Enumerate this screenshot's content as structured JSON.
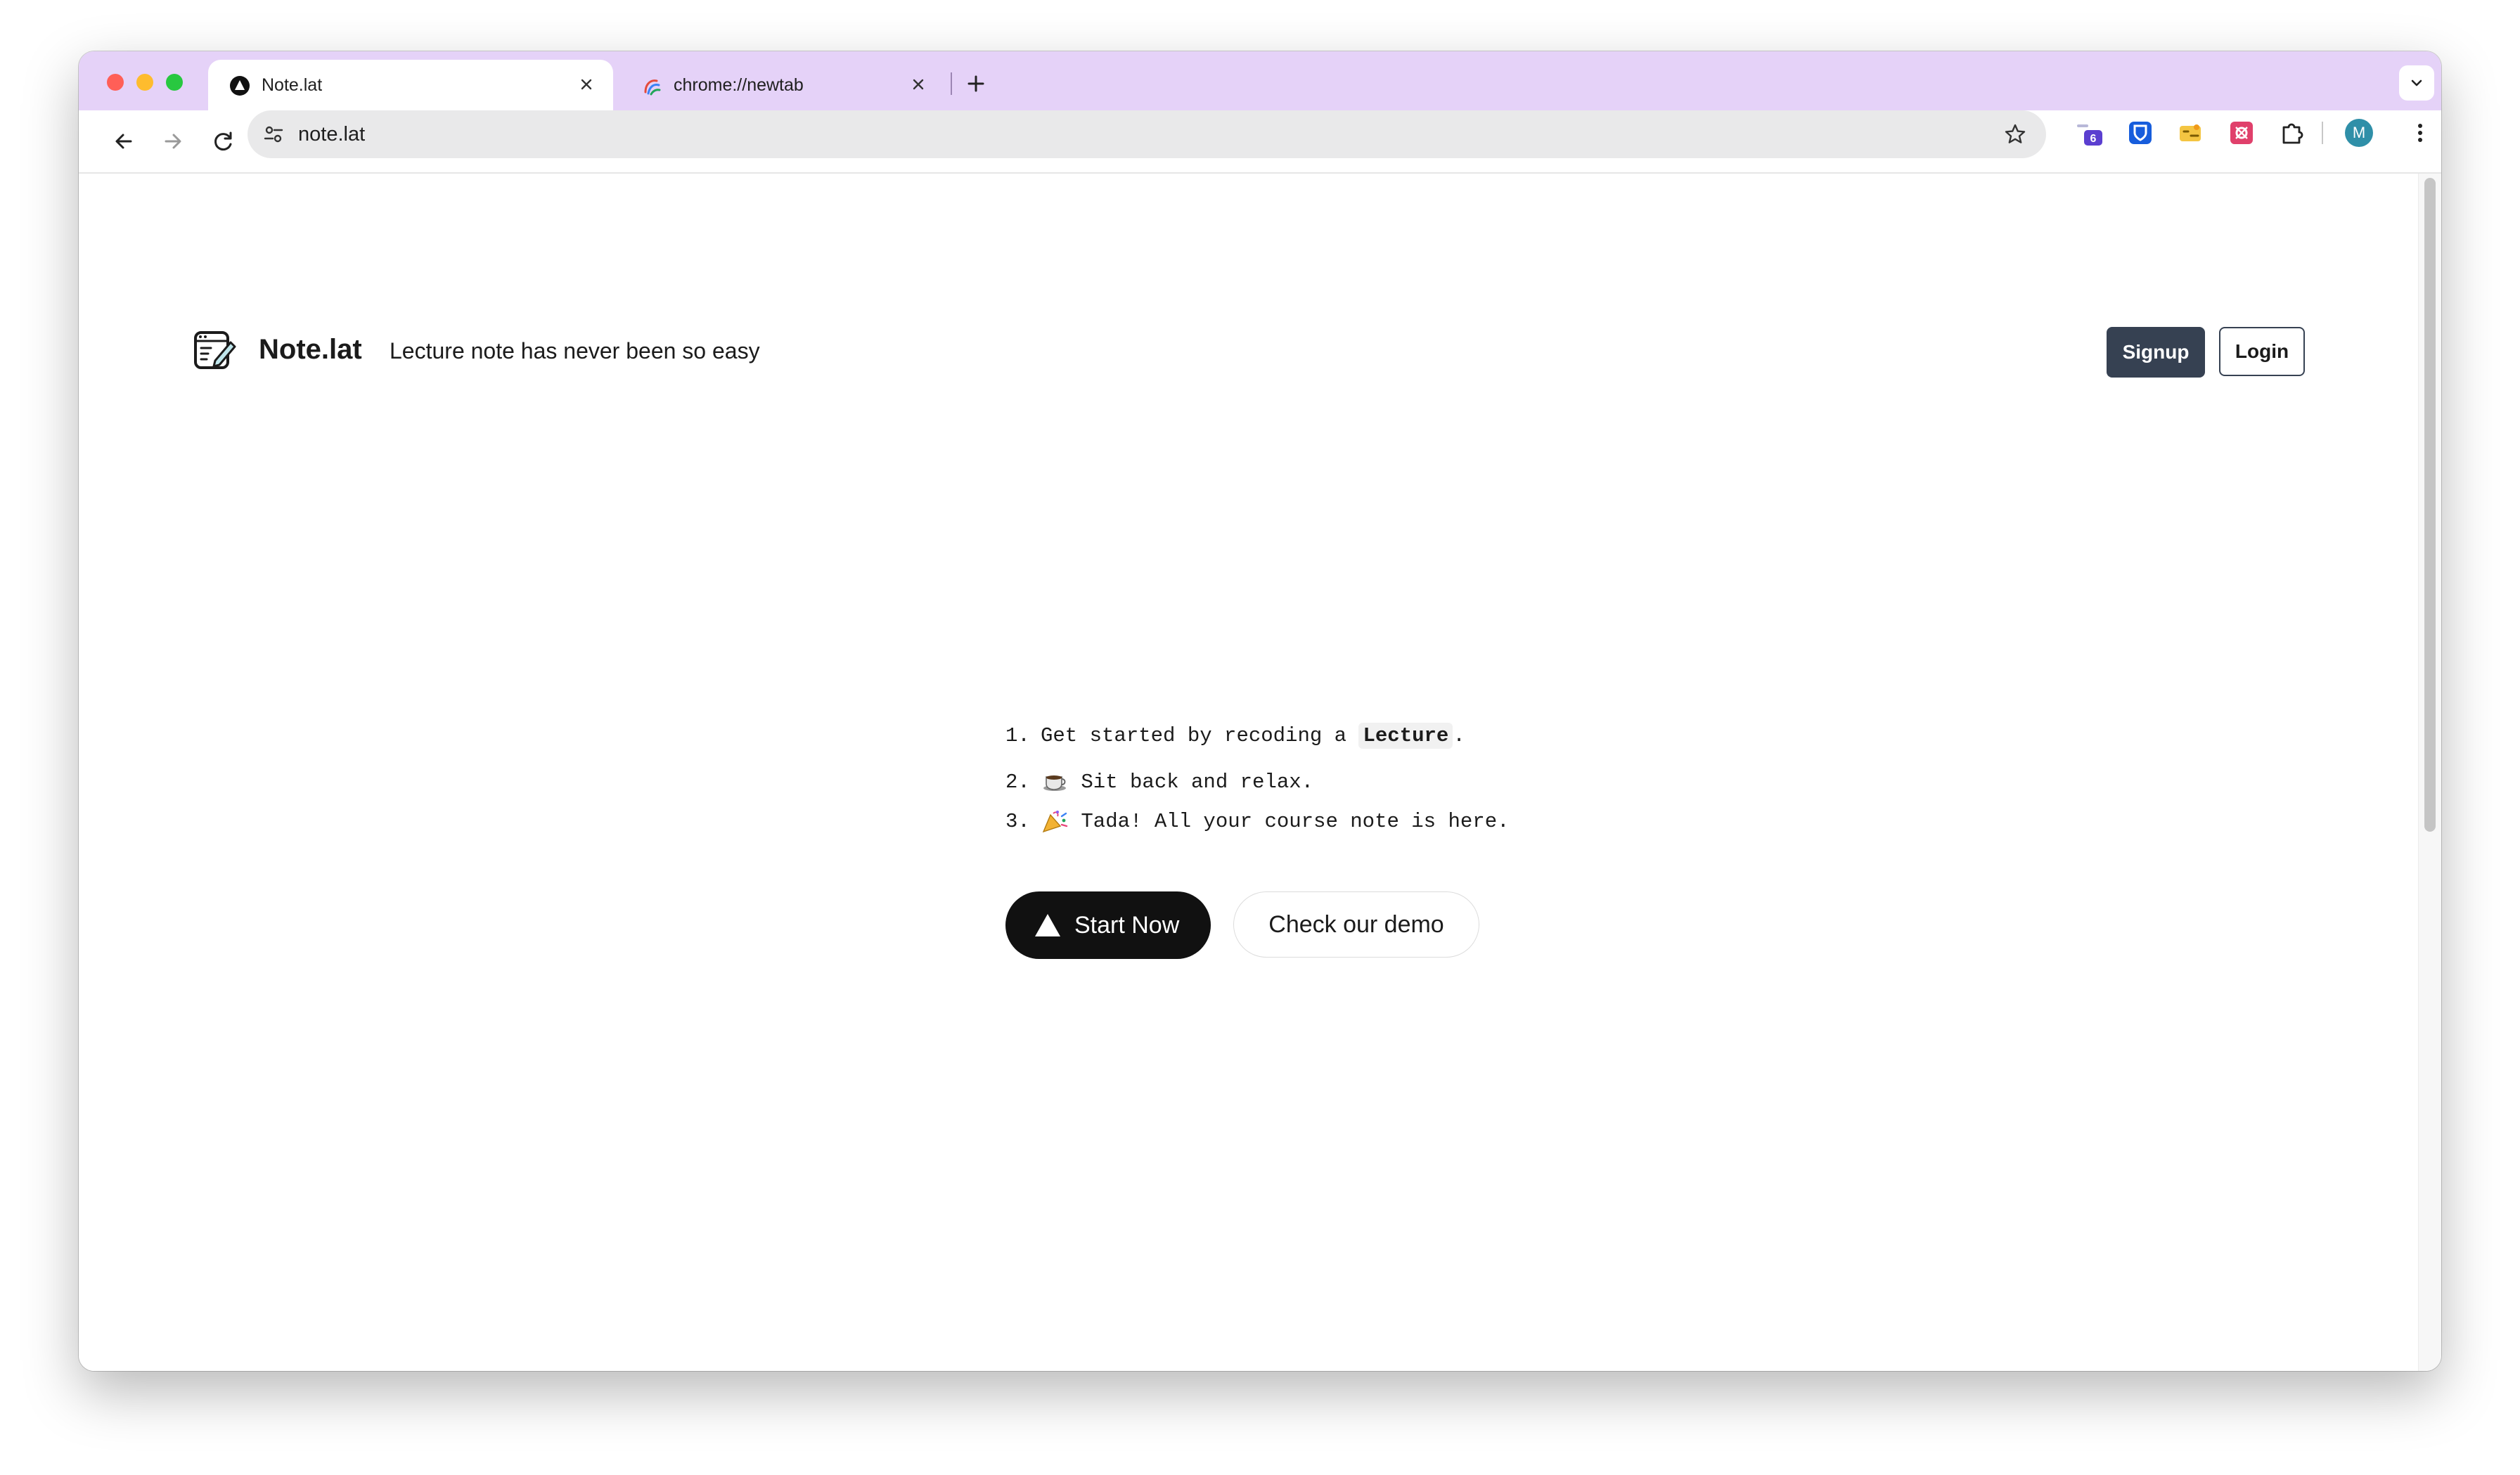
{
  "browser": {
    "tabs": [
      {
        "title": "Note.lat",
        "active": true,
        "favicon": "triangle-logo-icon"
      },
      {
        "title": "chrome://newtab",
        "active": false,
        "favicon": "chrome-newtab-icon"
      }
    ],
    "url": "note.lat",
    "extension_badge": "6",
    "profile_initial": "M",
    "tab_strip_color": "#e5d2f8"
  },
  "header": {
    "brand": "Note.lat",
    "tagline": "Lecture note has never been so easy",
    "signup_label": "Signup",
    "login_label": "Login"
  },
  "steps": [
    {
      "num": "1.",
      "before": "Get started by recoding a",
      "code": "Lecture",
      "after": "."
    },
    {
      "num": "2.",
      "emoji": "coffee",
      "text": "Sit back and relax."
    },
    {
      "num": "3.",
      "emoji": "party-popper",
      "text": "Tada! All your course note is here."
    }
  ],
  "cta": {
    "start_label": "Start Now",
    "demo_label": "Check our demo"
  },
  "colors": {
    "signup_bg": "#364152",
    "start_bg": "#111111"
  }
}
